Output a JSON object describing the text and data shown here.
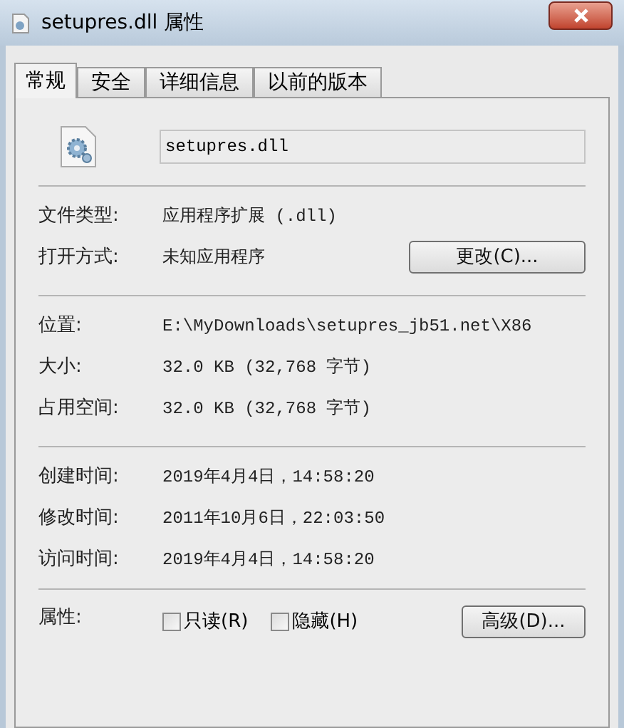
{
  "window": {
    "title": "setupres.dll 属性"
  },
  "tabs": [
    {
      "label": "常规",
      "selected": true
    },
    {
      "label": "安全",
      "selected": false
    },
    {
      "label": "详细信息",
      "selected": false
    },
    {
      "label": "以前的版本",
      "selected": false
    }
  ],
  "file_name": {
    "value": "setupres.dll"
  },
  "sections": [
    [
      {
        "label": "文件类型:",
        "value": "应用程序扩展 (.dll)"
      },
      {
        "label": "打开方式:",
        "value": "未知应用程序",
        "button": "更改(C)..."
      }
    ],
    [
      {
        "label": "位置:",
        "value": "E:\\MyDownloads\\setupres_jb51.net\\X86"
      },
      {
        "label": "大小:",
        "value": "32.0 KB (32,768 字节)"
      },
      {
        "label": "占用空间:",
        "value": "32.0 KB (32,768 字节)"
      }
    ],
    [
      {
        "label": "创建时间:",
        "value": "2019年4月4日，14:58:20"
      },
      {
        "label": "修改时间:",
        "value": "2011年10月6日，22:03:50"
      },
      {
        "label": "访问时间:",
        "value": "2019年4月4日，14:58:20"
      }
    ]
  ],
  "attributes": {
    "label": "属性:",
    "checkboxes": [
      {
        "label": "只读(R)",
        "checked": false
      },
      {
        "label": "隐藏(H)",
        "checked": false
      }
    ],
    "button": "高级(D)..."
  }
}
